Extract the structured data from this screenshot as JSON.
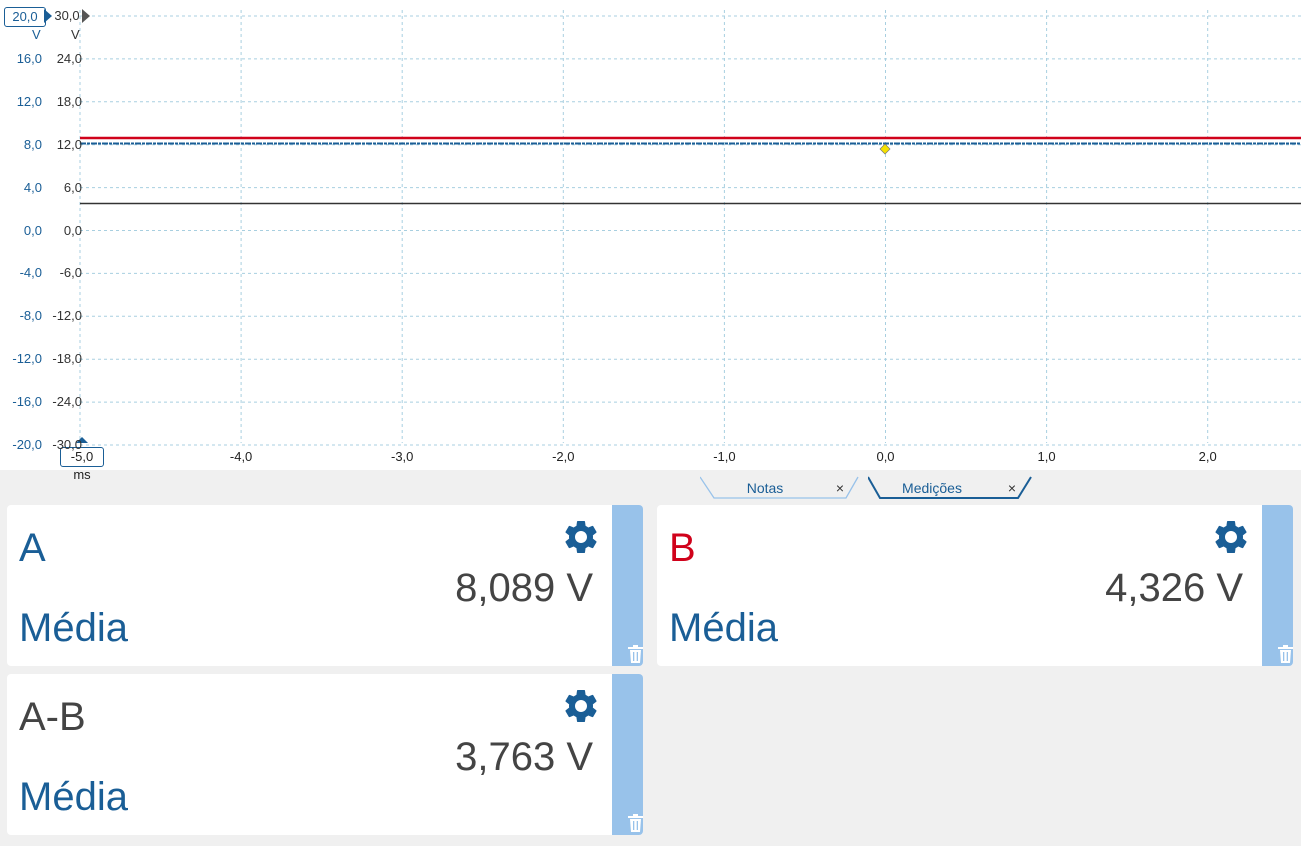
{
  "scope": {
    "channel_a_scale": "20,0",
    "channel_b_scale": "30,0",
    "channel_a_unit": "V",
    "channel_b_unit": "V",
    "y_ticks_a": [
      "16,0",
      "12,0",
      "8,0",
      "4,0",
      "0,0",
      "-4,0",
      "-8,0",
      "-12,0",
      "-16,0",
      "-20,0"
    ],
    "y_ticks_b": [
      "24,0",
      "18,0",
      "12,0",
      "6,0",
      "0,0",
      "-6,0",
      "-12,0",
      "-18,0",
      "-24,0",
      "-30,0"
    ],
    "x_start_label": "-5,0 ms",
    "x_ticks": [
      "-4,0",
      "-3,0",
      "-2,0",
      "-1,0",
      "0,0",
      "1,0",
      "2,0"
    ],
    "colors": {
      "channel_a": "#1a5e96",
      "channel_b": "#d0021b",
      "math": "#333333",
      "trigger": "#f5e100",
      "grid": "#a8cfe0"
    }
  },
  "tabs": [
    {
      "label": "Notas",
      "close": "×"
    },
    {
      "label": "Medições",
      "close": "×"
    }
  ],
  "measurements": [
    {
      "name": "A",
      "value": "8,089 V",
      "stat": "Média",
      "name_color": "#1a5e96",
      "icon": "gear-icon",
      "side_icon": "trash-icon"
    },
    {
      "name": "B",
      "value": "4,326 V",
      "stat": "Média",
      "name_color": "#d0021b",
      "icon": "gear-icon",
      "side_icon": "trash-icon"
    },
    {
      "name": "A-B",
      "value": "3,763 V",
      "stat": "Média",
      "name_color": "#444444",
      "icon": "gear-icon",
      "side_icon": "trash-icon"
    }
  ]
}
